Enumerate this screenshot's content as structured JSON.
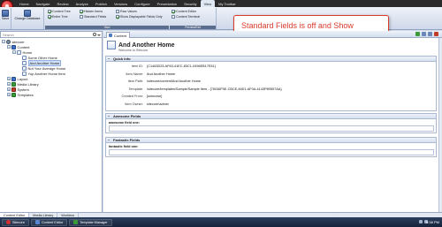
{
  "ribbon_tabs": [
    "Home",
    "Navigate",
    "Review",
    "Analyze",
    "Publish",
    "Versions",
    "Configure",
    "Presentation",
    "Security",
    "View",
    "My Toolbar"
  ],
  "active_tab": "View",
  "ribbon": {
    "save_label": "Save",
    "change_db_label": "Change Database",
    "content_tree": "Content Tree",
    "entire_tree": "Entire Tree",
    "hidden_items": "Hidden Items",
    "standard_fields": "Standard Fields",
    "raw_values": "Raw Values",
    "show_displayable": "Show Displayable Fields Only",
    "content_editor": "Content Editor",
    "content_terminal": "Content Terminal",
    "group_view": "View",
    "group_preview": "Preview/Exit"
  },
  "callout_text": "Standard Fields is off and Show Displayable Fields Only is on.",
  "search_placeholder": "Search",
  "tree": [
    {
      "label": "sitecore",
      "level": 0,
      "icon": "gear"
    },
    {
      "label": "Content",
      "level": 1,
      "icon": "blue"
    },
    {
      "label": "Home",
      "level": 2,
      "icon": "page"
    },
    {
      "label": "Some Other Home",
      "level": 3,
      "icon": "page"
    },
    {
      "label": "And Another Home",
      "level": 3,
      "icon": "page"
    },
    {
      "label": "Not Your Average Home",
      "level": 3,
      "icon": "page"
    },
    {
      "label": "Yup Another Home Item",
      "level": 3,
      "icon": "page"
    },
    {
      "label": "Layout",
      "level": 1,
      "icon": "blue"
    },
    {
      "label": "Media Library",
      "level": 1,
      "icon": "green"
    },
    {
      "label": "System",
      "level": 1,
      "icon": "red"
    },
    {
      "label": "Templates",
      "level": 1,
      "icon": "green"
    }
  ],
  "content_tab": "Content",
  "item": {
    "title": "And Another Home",
    "subtitle": "Welcome to Sitecore."
  },
  "quickinfo": {
    "header": "Quick Info",
    "rows": [
      {
        "label": "Item ID:",
        "value": "{C1463D23-AF63-41EC-83C1-0496EB17E51}"
      },
      {
        "label": "Item Name:",
        "value": "And Another Home"
      },
      {
        "label": "Item Path:",
        "value": "/sitecore/content/And Another Home"
      },
      {
        "label": "Template:",
        "value": "/sitecore/templates/Sample/Sample Item - {76036F5E-CBCE-46D1-AF0A-4143F9B557AA}"
      },
      {
        "label": "Created From:",
        "value": "[unknown]"
      },
      {
        "label": "Item Owner:",
        "value": "sitecore\\admin"
      }
    ]
  },
  "awesome": {
    "header": "Awesome Fields",
    "field": "awesome field one:"
  },
  "fantastic": {
    "header": "Fantastic Fields",
    "field": "fantastic field one:"
  },
  "bottom_tabs": [
    "Content Editor",
    "Media Library",
    "Workbox"
  ],
  "taskbar": {
    "start": "Sitecore",
    "items": [
      "Content Editor",
      "Template Manager"
    ],
    "clock": "9:38 PM"
  }
}
